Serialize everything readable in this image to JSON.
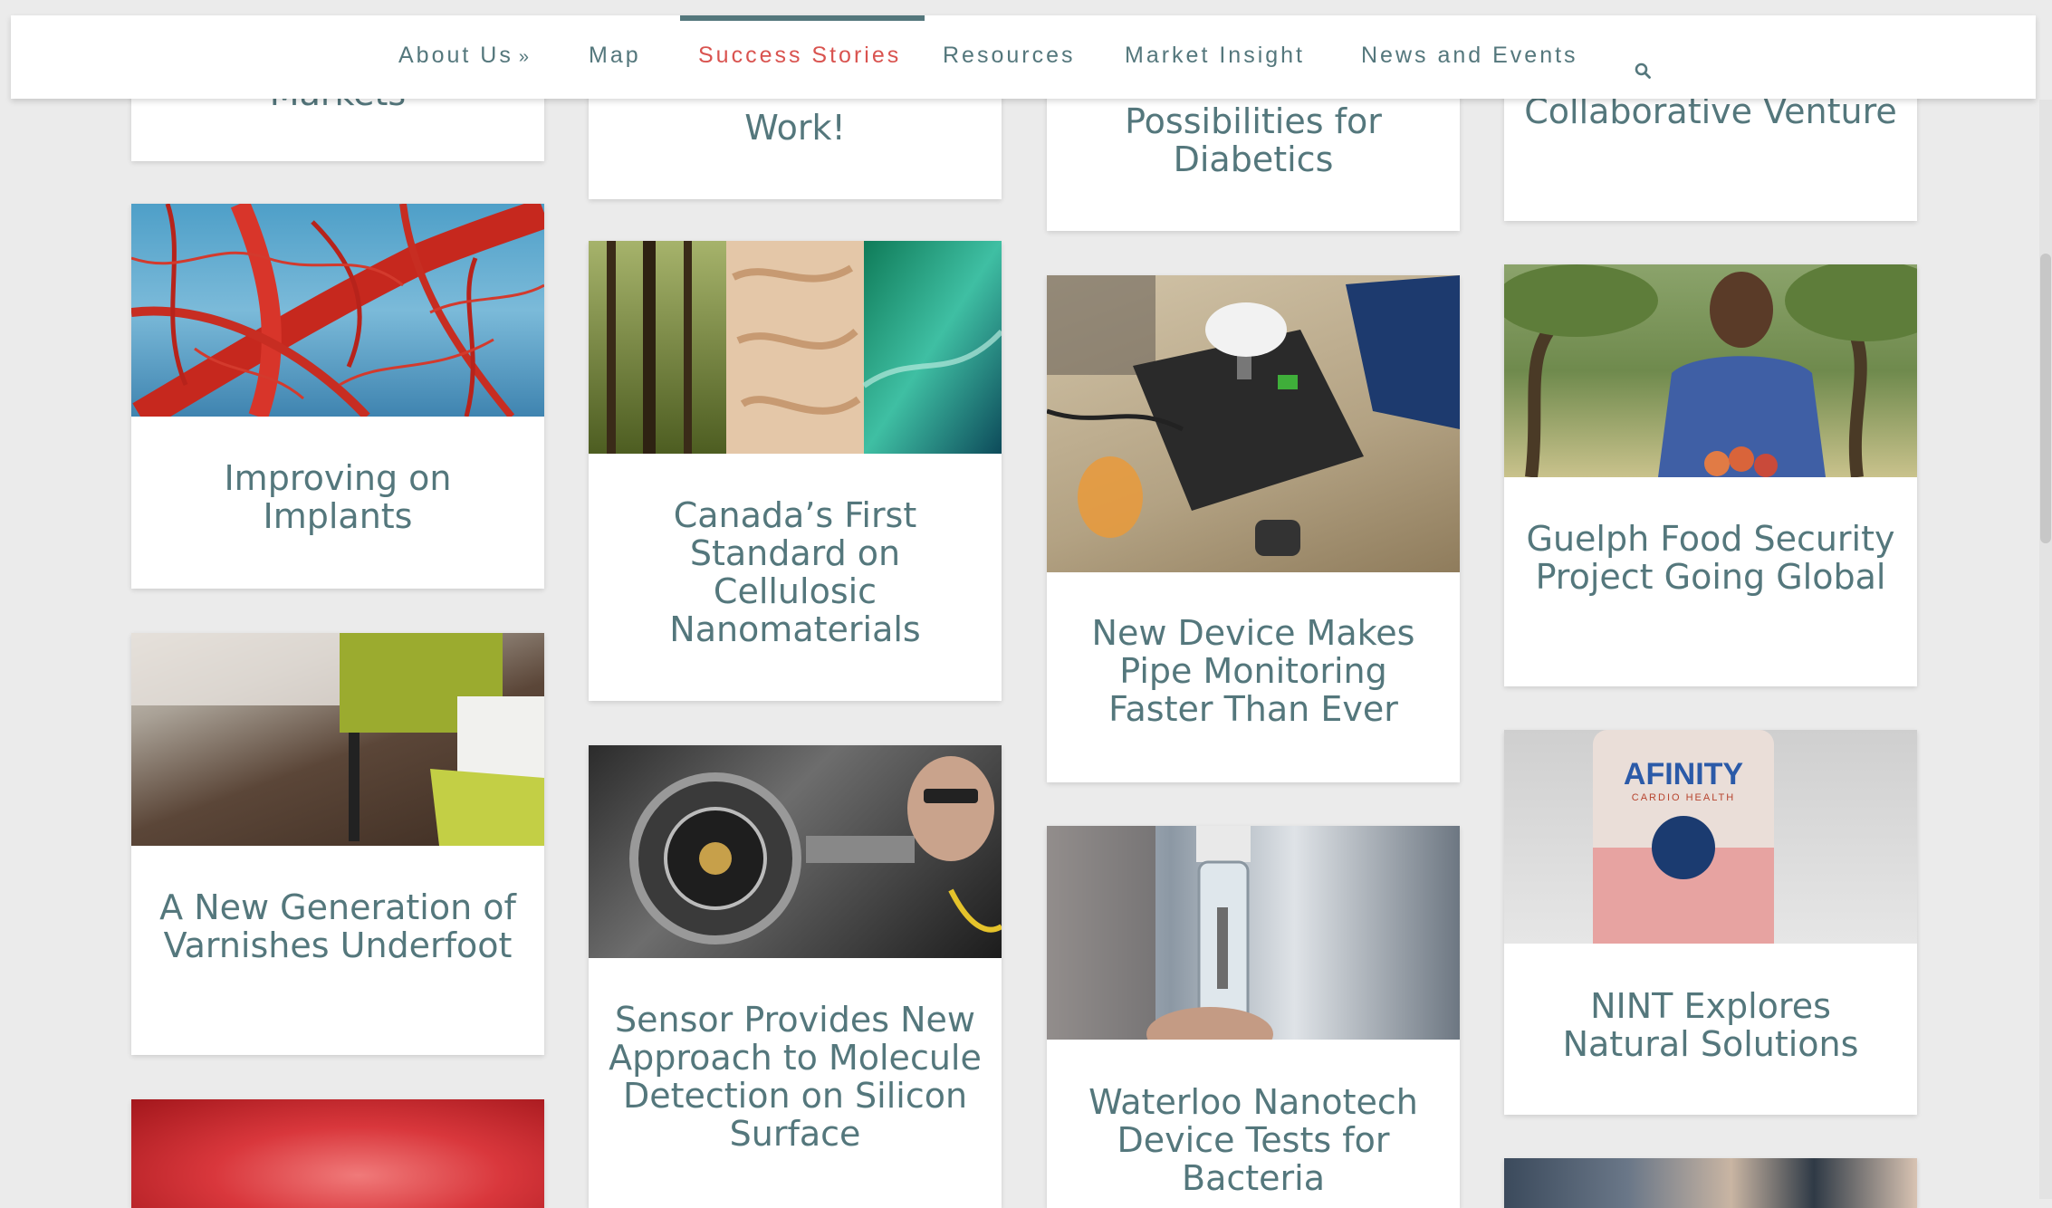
{
  "nav": {
    "items": [
      "About Us",
      "Map",
      "Success Stories",
      "Resources",
      "Market Insight",
      "News and Events"
    ],
    "about_chevron": "»",
    "active": "Success Stories"
  },
  "colors": {
    "text": "#54777c",
    "accent": "#d9534f",
    "card": "#ffffff",
    "background": "#ebebeb"
  },
  "icons": {
    "search": "search-icon"
  },
  "clipped_titles": [
    "Markets",
    "Work!",
    "Possibilities for Diabetics",
    "Collaborative Venture"
  ],
  "cards": [
    {
      "title": "Improving on Implants"
    },
    {
      "title": "A New Generation of Varnishes Underfoot"
    },
    {
      "title": "Canada’s First Standard on Cellulosic Nanomaterials"
    },
    {
      "title": "Sensor Provides New Approach to Molecule Detection on Silicon Surface"
    },
    {
      "title": "New Device Makes Pipe Monitoring Faster Than Ever"
    },
    {
      "title": "Waterloo Nanotech Device Tests for Bacteria"
    },
    {
      "title": "Guelph Food Security Project Going Global"
    },
    {
      "title": "NINT Explores Natural Solutions"
    }
  ],
  "product_label": {
    "brand": "AFINITY",
    "sub": "CARDIO HEALTH"
  }
}
